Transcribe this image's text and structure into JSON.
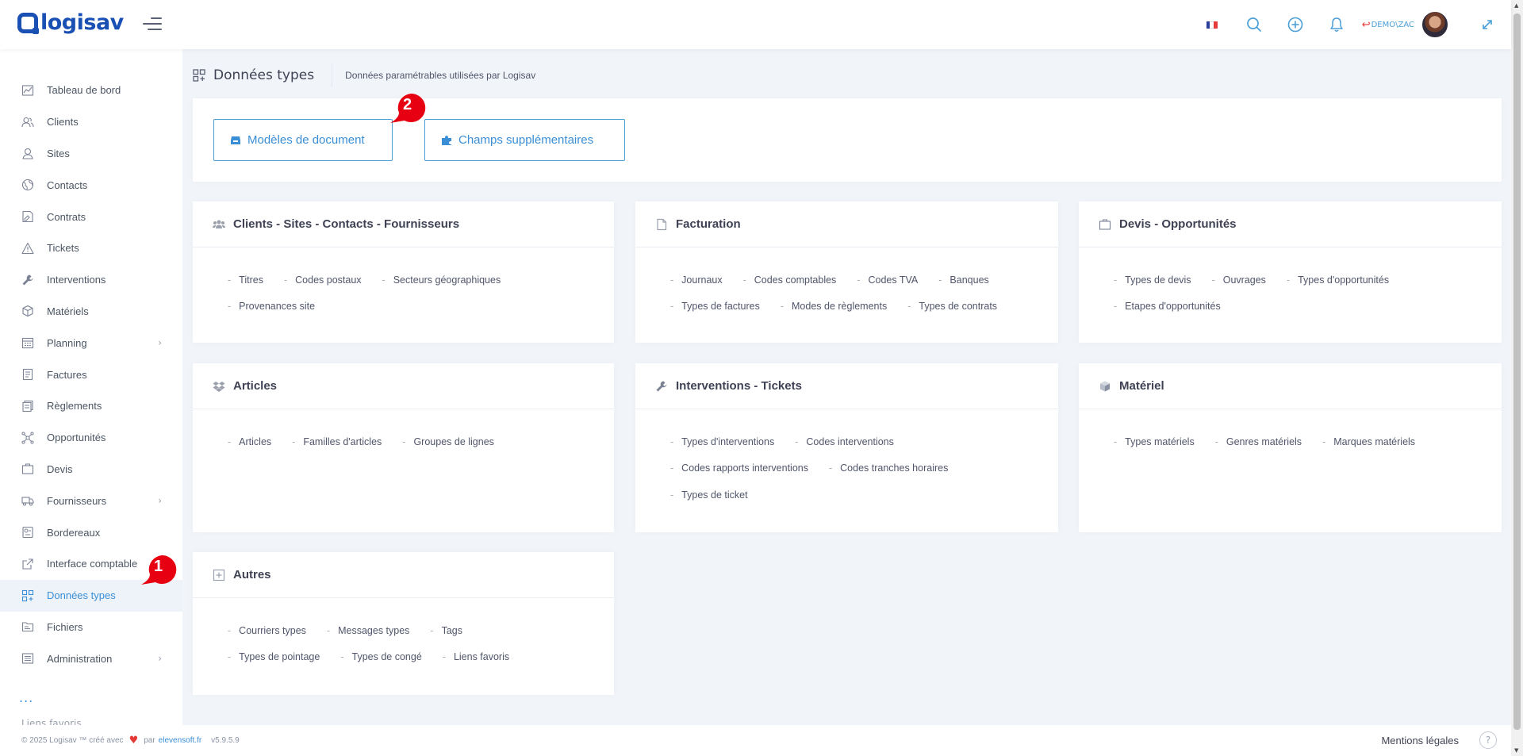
{
  "header": {
    "logo_text": "logisav",
    "user_label": "DEMO\\ZAC"
  },
  "sidebar": {
    "items": [
      {
        "label": "Tableau de bord",
        "icon": "chart-icon",
        "name": "sidebar-item-tableau-de-bord"
      },
      {
        "label": "Clients",
        "icon": "users-icon",
        "name": "sidebar-item-clients"
      },
      {
        "label": "Sites",
        "icon": "location-icon",
        "name": "sidebar-item-sites"
      },
      {
        "label": "Contacts",
        "icon": "globe-icon",
        "name": "sidebar-item-contacts"
      },
      {
        "label": "Contrats",
        "icon": "contract-icon",
        "name": "sidebar-item-contrats"
      },
      {
        "label": "Tickets",
        "icon": "warning-icon",
        "name": "sidebar-item-tickets"
      },
      {
        "label": "Interventions",
        "icon": "wrench-icon",
        "name": "sidebar-item-interventions"
      },
      {
        "label": "Matériels",
        "icon": "box-icon",
        "name": "sidebar-item-materiels"
      },
      {
        "label": "Planning",
        "icon": "calendar-icon",
        "name": "sidebar-item-planning",
        "chevron": true
      },
      {
        "label": "Factures",
        "icon": "invoice-icon",
        "name": "sidebar-item-factures"
      },
      {
        "label": "Règlements",
        "icon": "payments-icon",
        "name": "sidebar-item-reglements"
      },
      {
        "label": "Opportunités",
        "icon": "network-icon",
        "name": "sidebar-item-opportunites"
      },
      {
        "label": "Devis",
        "icon": "briefcase-icon",
        "name": "sidebar-item-devis"
      },
      {
        "label": "Fournisseurs",
        "icon": "truck-icon",
        "name": "sidebar-item-fournisseurs",
        "chevron": true
      },
      {
        "label": "Bordereaux",
        "icon": "slip-icon",
        "name": "sidebar-item-bordereaux"
      },
      {
        "label": "Interface comptable",
        "icon": "external-link-icon",
        "name": "sidebar-item-interface-comptable"
      },
      {
        "label": "Données types",
        "icon": "grid-plus-icon",
        "name": "sidebar-item-donnees-types",
        "active": true
      },
      {
        "label": "Fichiers",
        "icon": "folder-icon",
        "name": "sidebar-item-fichiers"
      },
      {
        "label": "Administration",
        "icon": "settings-panel-icon",
        "name": "sidebar-item-administration",
        "chevron": true
      }
    ],
    "more": "...",
    "cut_item": "Liens favoris"
  },
  "page": {
    "title": "Données types",
    "subtitle": "Données paramétrables utilisées par Logisav"
  },
  "toolbar": {
    "doc_models": "Modèles de document",
    "extra_fields": "Champs supplémentaires"
  },
  "sections": [
    {
      "title": "Clients - Sites - Contacts - Fournisseurs",
      "icon": "users-group-icon",
      "links": [
        "Titres",
        "Codes postaux",
        "Secteurs géographiques",
        "Provenances site"
      ]
    },
    {
      "title": "Facturation",
      "icon": "file-icon",
      "links": [
        "Journaux",
        "Codes comptables",
        "Codes TVA",
        "Banques",
        "Types de factures",
        "Modes de règlements",
        "Types de contrats"
      ]
    },
    {
      "title": "Devis - Opportunités",
      "icon": "briefcase-icon",
      "links": [
        "Types de devis",
        "Ouvrages",
        "Types d'opportunités",
        "Etapes d'opportunités"
      ]
    },
    {
      "title": "Articles",
      "icon": "dropbox-icon",
      "links": [
        "Articles",
        "Familles d'articles",
        "Groupes de lignes"
      ]
    },
    {
      "title": "Interventions - Tickets",
      "icon": "wrench-icon",
      "links": [
        "Types d'interventions",
        "Codes interventions",
        "Codes rapports interventions",
        "Codes tranches horaires",
        "Types de ticket"
      ]
    },
    {
      "title": "Matériel",
      "icon": "cube-icon",
      "links": [
        "Types matériels",
        "Genres matériels",
        "Marques matériels"
      ]
    },
    {
      "title": "Autres",
      "icon": "plus-square-icon",
      "links": [
        "Courriers types",
        "Messages types",
        "Tags",
        "Types de pointage",
        "Types de congé",
        "Liens favoris"
      ]
    }
  ],
  "footer": {
    "copyright": "© 2025 Logisav ™ créé avec",
    "par": "par",
    "link": "elevensoft.fr",
    "version": "v5.9.5.9",
    "mentions": "Mentions légales",
    "help": "?"
  },
  "callouts": [
    "1",
    "2"
  ],
  "colors": {
    "brand": "#1a4fb4",
    "accent": "#3a8ed6",
    "callout": "#e60012"
  }
}
